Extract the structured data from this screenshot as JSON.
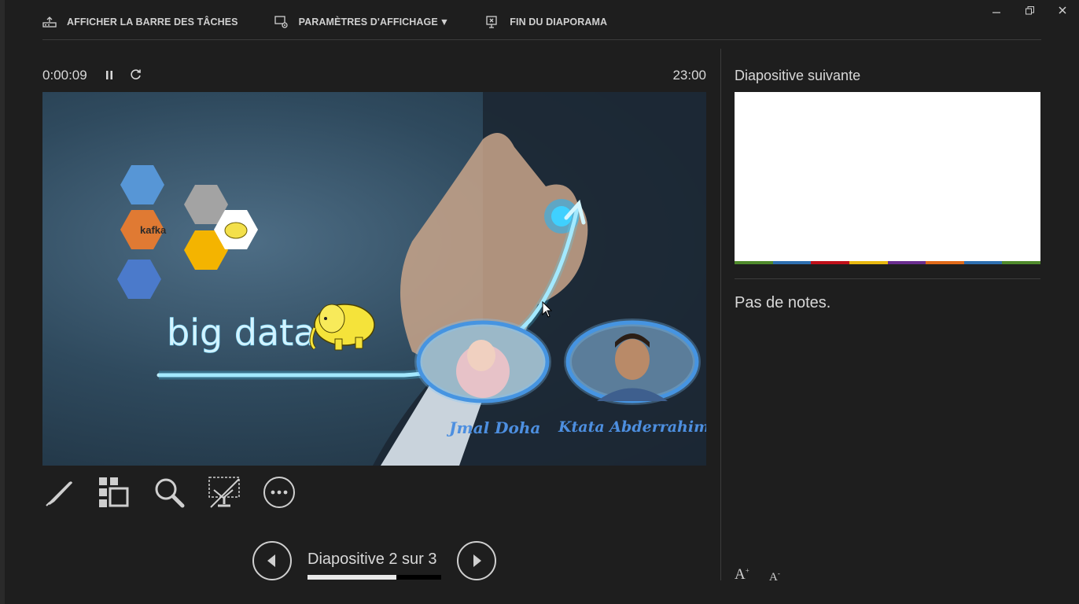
{
  "toolbar": {
    "taskbar_label": "AFFICHER LA BARRE DES TÂCHES",
    "display_settings_label": "PARAMÈTRES D'AFFICHAGE",
    "end_show_label": "FIN DU DIAPORAMA"
  },
  "timer": {
    "elapsed": "0:00:09",
    "clock": "23:00"
  },
  "slide": {
    "title_text": "big data",
    "kafka_text": "kafka",
    "author1": "Jmal Doha",
    "author2": "Ktata Abderrahim"
  },
  "navigation": {
    "counter": "Diapositive 2 sur 3",
    "progress_fraction": 0.667
  },
  "next_slide": {
    "title": "Diapositive suivante",
    "strip_colors": [
      "#4f8a2c",
      "#2e6fb0",
      "#c0101a",
      "#e8b810",
      "#6a2d8f",
      "#e06a1a",
      "#2e6fb0",
      "#4f8a2c"
    ]
  },
  "notes": {
    "text": "Pas de notes."
  },
  "font_controls": {
    "increase": "A",
    "decrease": "A"
  },
  "colors": {
    "background": "#1e1e1e",
    "text": "#d8d8d8",
    "accent_blue": "#4aa3ff"
  }
}
